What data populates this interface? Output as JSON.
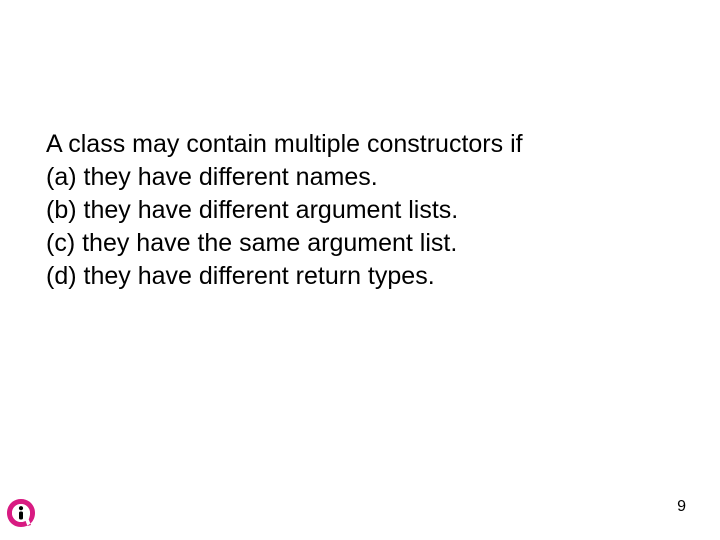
{
  "question": {
    "stem": "A class may contain multiple constructors if",
    "options": [
      "(a) they have different names.",
      "(b) they have different argument lists.",
      "(c) they have the same argument list.",
      "(d) they have different return types."
    ]
  },
  "page_number": "9",
  "logo": {
    "brand_color": "#d81b82",
    "monogram": "i"
  }
}
